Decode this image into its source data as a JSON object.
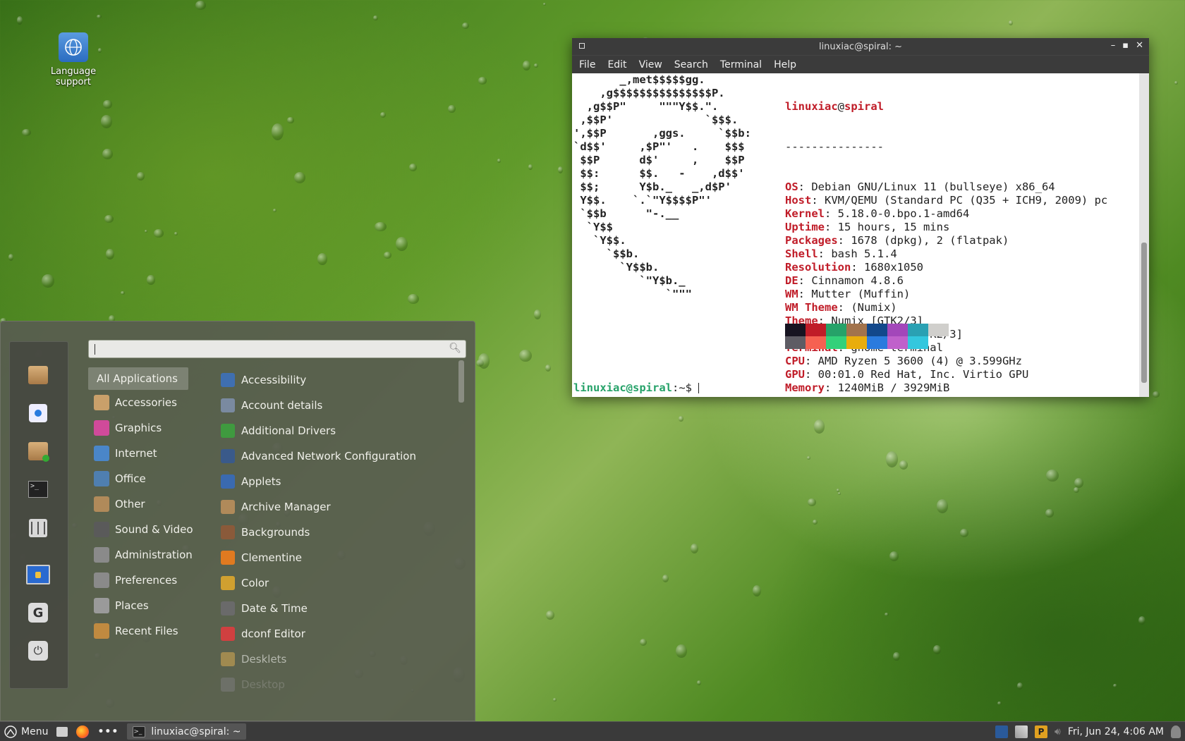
{
  "desktop": {
    "icons": [
      {
        "label_line1": "Language",
        "label_line2": "support",
        "icon": "globe-icon"
      }
    ]
  },
  "terminal": {
    "title": "linuxiac@spiral: ~",
    "menu": [
      "File",
      "Edit",
      "View",
      "Search",
      "Terminal",
      "Help"
    ],
    "ascii_logo": [
      "       _,met$$$$$gg.",
      "    ,g$$$$$$$$$$$$$$$P.",
      "  ,g$$P\"     \"\"\"Y$$.\".",
      " ,$$P'              `$$$.",
      "',$$P       ,ggs.     `$$b:",
      "`d$$'     ,$P\"'   .    $$$",
      " $$P      d$'     ,    $$P",
      " $$:      $$.   -    ,d$$'",
      " $$;      Y$b._   _,d$P'",
      " Y$$.    `.`\"Y$$$$P\"'",
      " `$$b      \"-.__",
      "  `Y$$",
      "   `Y$$.",
      "     `$$b.",
      "       `Y$$b.",
      "          `\"Y$b._",
      "              `\"\"\""
    ],
    "user_host_user": "linuxiac",
    "user_host_at": "@",
    "user_host_host": "spiral",
    "separator": "---------------",
    "info": [
      {
        "key": "OS",
        "value": ": Debian GNU/Linux 11 (bullseye) x86_64"
      },
      {
        "key": "Host",
        "value": ": KVM/QEMU (Standard PC (Q35 + ICH9, 2009) pc"
      },
      {
        "key": "Kernel",
        "value": ": 5.18.0-0.bpo.1-amd64"
      },
      {
        "key": "Uptime",
        "value": ": 15 hours, 15 mins"
      },
      {
        "key": "Packages",
        "value": ": 1678 (dpkg), 2 (flatpak)"
      },
      {
        "key": "Shell",
        "value": ": bash 5.1.4"
      },
      {
        "key": "Resolution",
        "value": ": 1680x1050"
      },
      {
        "key": "DE",
        "value": ": Cinnamon 4.8.6"
      },
      {
        "key": "WM",
        "value": ": Mutter (Muffin)"
      },
      {
        "key": "WM Theme",
        "value": ": (Numix)"
      },
      {
        "key": "Theme",
        "value": ": Numix [GTK2/3]"
      },
      {
        "key": "Icons",
        "value": ": Faenza-Dark [GTK2/3]"
      },
      {
        "key": "Terminal",
        "value": ": gnome-terminal"
      },
      {
        "key": "CPU",
        "value": ": AMD Ryzen 5 3600 (4) @ 3.599GHz"
      },
      {
        "key": "GPU",
        "value": ": 00:01.0 Red Hat, Inc. Virtio GPU"
      },
      {
        "key": "Memory",
        "value": ": 1240MiB / 3929MiB"
      }
    ],
    "palette_row1": [
      "#171421",
      "#c01c28",
      "#26a269",
      "#a2734c",
      "#12488b",
      "#a347ba",
      "#2aa1b3",
      "#d0cfcc"
    ],
    "palette_row2": [
      "#5e5c64",
      "#f66151",
      "#33d17a",
      "#e9ad0c",
      "#2a7bde",
      "#c061cb",
      "#33c7de"
    ],
    "prompt_user": "linuxiac@spiral",
    "prompt_rest": ":~$ "
  },
  "menu": {
    "search_placeholder": "",
    "favorites": [
      "package-icon",
      "software-store-icon",
      "package-install-icon",
      "terminal-icon",
      "settings-sliders-icon",
      "lock-screen-icon",
      "logout-icon",
      "power-icon"
    ],
    "categories": [
      {
        "label": "All Applications",
        "color": ""
      },
      {
        "label": "Accessories",
        "color": "#c9a06a"
      },
      {
        "label": "Graphics",
        "color": "#d04a9a"
      },
      {
        "label": "Internet",
        "color": "#4a86c8"
      },
      {
        "label": "Office",
        "color": "#4f7fb0"
      },
      {
        "label": "Other",
        "color": "#b08a5a"
      },
      {
        "label": "Sound & Video",
        "color": "#5a5a5a"
      },
      {
        "label": "Administration",
        "color": "#8a8a8a"
      },
      {
        "label": "Preferences",
        "color": "#8a8a8a"
      },
      {
        "label": "Places",
        "color": "#9a9a9a"
      },
      {
        "label": "Recent Files",
        "color": "#c08a40"
      }
    ],
    "apps": [
      {
        "label": "Accessibility",
        "color": "#3f6fb0"
      },
      {
        "label": "Account details",
        "color": "#7a8aa0"
      },
      {
        "label": "Additional Drivers",
        "color": "#3f9a3f"
      },
      {
        "label": "Advanced Network Configuration",
        "color": "#3a5a8a"
      },
      {
        "label": "Applets",
        "color": "#3a6ab0"
      },
      {
        "label": "Archive Manager",
        "color": "#b08a5a"
      },
      {
        "label": "Backgrounds",
        "color": "#8a5a3a"
      },
      {
        "label": "Clementine",
        "color": "#e07a20"
      },
      {
        "label": "Color",
        "color": "#d0a030"
      },
      {
        "label": "Date & Time",
        "color": "#6a6a6a"
      },
      {
        "label": "dconf Editor",
        "color": "#d04040"
      },
      {
        "label": "Desklets",
        "color": "#a08a50"
      },
      {
        "label": "Desktop",
        "color": "#7a7a7a"
      }
    ]
  },
  "panel": {
    "menu_label": "Menu",
    "task_label": "linuxiac@spiral: ~",
    "clock": "Fri, Jun 24,  4:06 AM"
  }
}
